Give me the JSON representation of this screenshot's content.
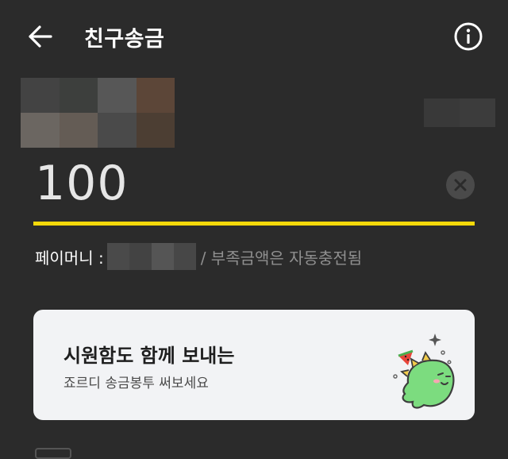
{
  "header": {
    "title": "친구송금"
  },
  "icons": {
    "back": "arrow-left-icon",
    "info": "info-icon",
    "clear": "clear-icon"
  },
  "amount": {
    "value": "100"
  },
  "balance": {
    "label": "페이머니 :",
    "note": "/ 부족금액은 자동충전됨"
  },
  "promo": {
    "title": "시원함도 함께 보내는",
    "subtitle": "죠르디 송금봉투 써보세요"
  },
  "colors": {
    "background": "#2b2b2b",
    "accent": "#f5d90a",
    "card": "#f2f3f5"
  }
}
